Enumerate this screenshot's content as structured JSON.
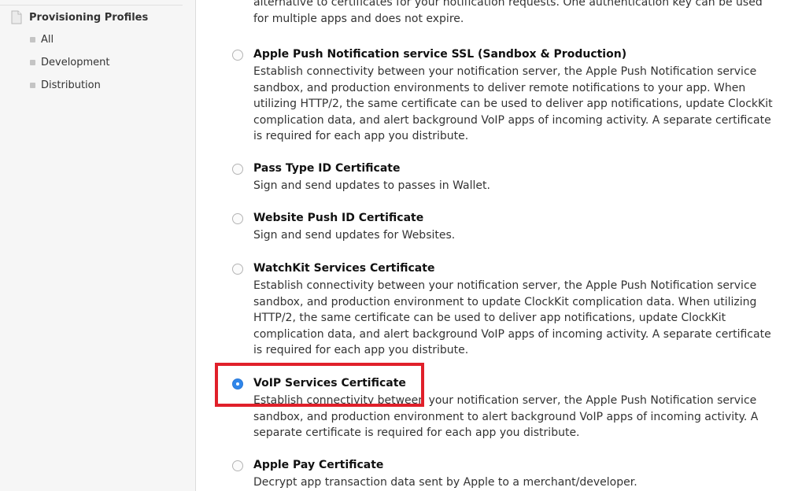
{
  "sidebar": {
    "section_label": "Provisioning Profiles",
    "items": [
      {
        "label": "All"
      },
      {
        "label": "Development"
      },
      {
        "label": "Distribution"
      }
    ]
  },
  "main": {
    "intro_text": "alternative to certificates for your notification requests. One authentication key can be used for multiple apps and does not expire.",
    "options": [
      {
        "title": "Apple Push Notification service SSL (Sandbox & Production)",
        "description": "Establish connectivity between your notification server, the Apple Push Notification service sandbox, and production environments to deliver remote notifications to your app. When utilizing HTTP/2, the same certificate can be used to deliver app notifications, update ClockKit complication data, and alert background VoIP apps of incoming activity. A separate certificate is required for each app you distribute.",
        "selected": false
      },
      {
        "title": "Pass Type ID Certificate",
        "description": "Sign and send updates to passes in Wallet.",
        "selected": false
      },
      {
        "title": "Website Push ID Certificate",
        "description": "Sign and send updates for Websites.",
        "selected": false
      },
      {
        "title": "WatchKit Services Certificate",
        "description": "Establish connectivity between your notification server, the Apple Push Notification service sandbox, and production environment to update ClockKit complication data. When utilizing HTTP/2, the same certificate can be used to deliver app notifications, update ClockKit complication data, and alert background VoIP apps of incoming activity. A separate certificate is required for each app you distribute.",
        "selected": false
      },
      {
        "title": "VoIP Services Certificate",
        "description": "Establish connectivity between your notification server, the Apple Push Notification service sandbox, and production environment to alert background VoIP apps of incoming activity. A separate certificate is required for each app you distribute.",
        "selected": true
      },
      {
        "title": "Apple Pay Certificate",
        "description": "Decrypt app transaction data sent by Apple to a merchant/developer.",
        "selected": false
      }
    ]
  },
  "colors": {
    "radio_selected": "#2f86ea",
    "highlight_border": "#e0202a",
    "sidebar_background": "#f6f6f6"
  },
  "icons": {
    "sidebar_section": "document-icon",
    "sidebar_item": "square-bullet-icon"
  }
}
